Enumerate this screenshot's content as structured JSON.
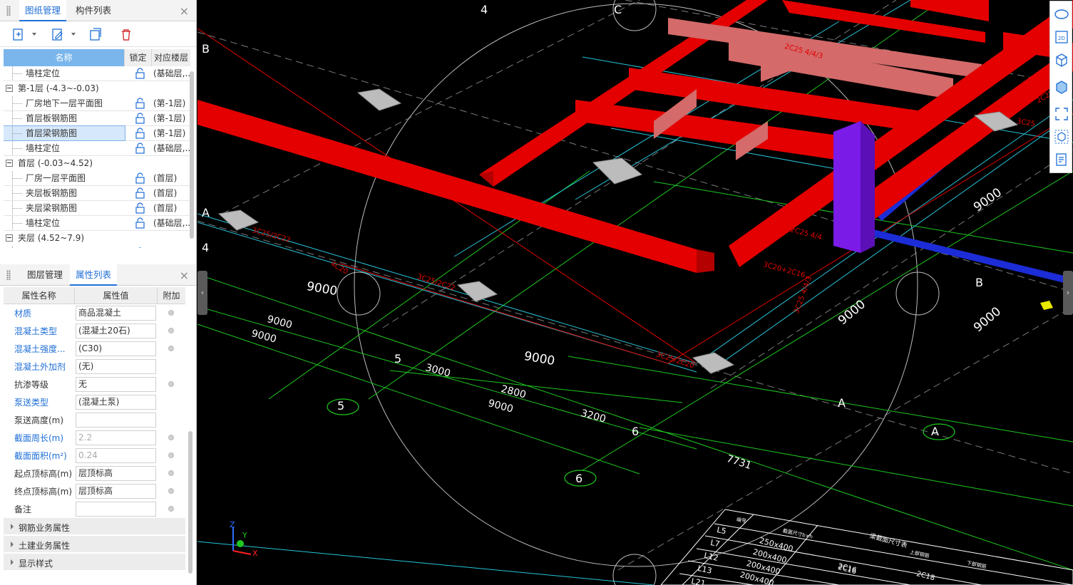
{
  "top_panel": {
    "tabs": [
      "图纸管理",
      "构件列表"
    ],
    "close": "×",
    "columns": {
      "name": "名称",
      "lock": "锁定",
      "floor": "对应楼层"
    },
    "rows": [
      {
        "type": "leaf",
        "name": "墙柱定位",
        "floor": "(基础层,..."
      },
      {
        "type": "group",
        "name": "第-1层 (-4.3~-0.03)"
      },
      {
        "type": "leaf",
        "name": "厂房地下一层平面图",
        "floor": "(第-1层)"
      },
      {
        "type": "leaf",
        "name": "首层板钢筋图",
        "floor": "(第-1层)"
      },
      {
        "type": "leaf",
        "name": "首层梁钢筋图",
        "floor": "(第-1层)",
        "selected": true
      },
      {
        "type": "leaf",
        "name": "墙柱定位",
        "floor": "(基础层,..."
      },
      {
        "type": "group",
        "name": "首层 (-0.03~4.52)"
      },
      {
        "type": "leaf",
        "name": "厂房一层平面图",
        "floor": "(首层)"
      },
      {
        "type": "leaf",
        "name": "夹层板钢筋图",
        "floor": "(首层)"
      },
      {
        "type": "leaf",
        "name": "夹层梁钢筋图",
        "floor": "(首层)"
      },
      {
        "type": "leaf",
        "name": "墙柱定位",
        "floor": "(基础层,..."
      },
      {
        "type": "group",
        "name": "夹层 (4.52~7.9)"
      },
      {
        "type": "leaf",
        "name": "厂房二层平面图",
        "floor": "(夹层)"
      }
    ]
  },
  "bottom_panel": {
    "tabs": [
      "图层管理",
      "属性列表"
    ],
    "close": "×",
    "columns": {
      "name": "属性名称",
      "value": "属性值",
      "extra": "附加"
    },
    "props": [
      {
        "name": "材质",
        "value": "商品混凝土",
        "blue": true,
        "radio": true
      },
      {
        "name": "混凝土类型",
        "value": "(混凝土20石)",
        "blue": true,
        "radio": true
      },
      {
        "name": "混凝土强度...",
        "value": "(C30)",
        "blue": true,
        "radio": true
      },
      {
        "name": "混凝土外加剂",
        "value": "(无)",
        "blue": true,
        "radio": false
      },
      {
        "name": "抗渗等级",
        "value": "无",
        "blue": false,
        "radio": true
      },
      {
        "name": "泵送类型",
        "value": "(混凝土泵)",
        "blue": true,
        "radio": false
      },
      {
        "name": "泵送高度(m)",
        "value": "",
        "blue": false,
        "radio": false
      },
      {
        "name": "截面周长(m)",
        "value": "2.2",
        "blue": true,
        "radio": true,
        "disabled": true
      },
      {
        "name": "截面面积(m²)",
        "value": "0.24",
        "blue": true,
        "radio": true,
        "disabled": true
      },
      {
        "name": "起点顶标高(m)",
        "value": "层顶标高",
        "blue": false,
        "radio": true
      },
      {
        "name": "终点顶标高(m)",
        "value": "层顶标高",
        "blue": false,
        "radio": true
      },
      {
        "name": "备注",
        "value": "",
        "blue": false,
        "radio": true
      }
    ],
    "groups": [
      "钢筋业务属性",
      "土建业务属性",
      "显示样式"
    ]
  },
  "canvas": {
    "axis_labels": [
      "4",
      "C",
      "B",
      "A",
      "4",
      "B",
      "A",
      "5",
      "5",
      "6",
      "6",
      "A"
    ],
    "dimensions": [
      "9000",
      "9000",
      "9000",
      "9000",
      "9000",
      "3000",
      "2800",
      "9000",
      "3200",
      "9000",
      "7731",
      "9000"
    ],
    "rebar_labels": [
      "3C25/2C22",
      "3C25/2C22",
      "3C25/2C20",
      "4C20",
      "2C25 4/4/3",
      "2C25 4/4",
      "3C20+2C16",
      "3C25 4/4/3",
      "2C25 4/4",
      "3C25 3/5",
      "3C25"
    ],
    "table": {
      "title": "梁截面尺寸表",
      "headers": [
        "编号",
        "截面尺寸b×h",
        "上部钢筋",
        "下部钢筋"
      ],
      "rows": [
        {
          "id": "L5",
          "size": "250x400",
          "top": "",
          "bottom": ""
        },
        {
          "id": "L7",
          "size": "200x400",
          "top": "2C16",
          "bottom": ""
        },
        {
          "id": "L12",
          "size": "200x400",
          "top": "2C16",
          "bottom": "2C18"
        },
        {
          "id": "L13",
          "size": "200x400",
          "top": "",
          "bottom": ""
        },
        {
          "id": "L21",
          "size": "",
          "top": "",
          "bottom": ""
        }
      ]
    },
    "coord_axes": {
      "x": "X",
      "y": "Y",
      "z": "Z"
    }
  },
  "right_toolbar": [
    "orbit-icon",
    "2d-view-icon",
    "3d-box-icon",
    "solid-box-icon",
    "fit-view-icon",
    "cube-select-icon",
    "property-sheet-icon"
  ],
  "colors": {
    "accent": "#1f6fd6",
    "beam": "#e40000",
    "column": "#7a1be8",
    "grid_green": "#1ec81e",
    "grid_cyan": "#27c4d9"
  }
}
